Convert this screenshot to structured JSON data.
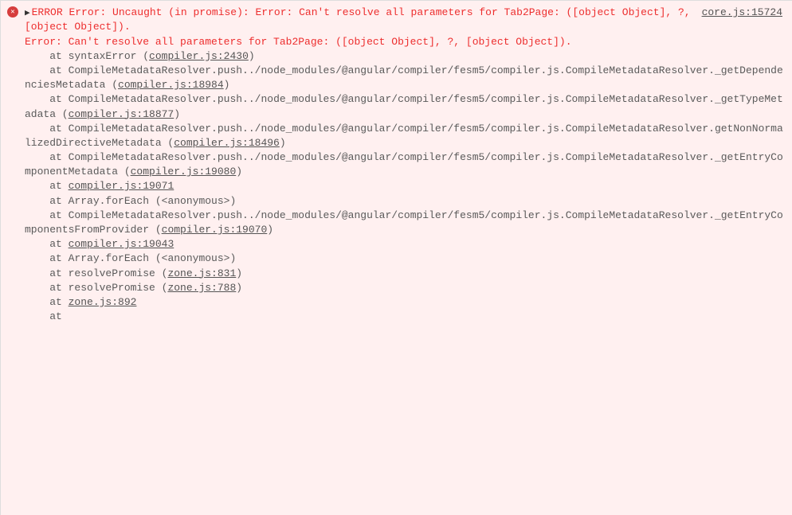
{
  "error": {
    "sourceLink": "core.js:15724",
    "headerPrefix": "ERROR",
    "headerMain": "Error: Uncaught (in promise): Error: Can't resolve all parameters for Tab2Page: ([object Object], ?, [object Object]).",
    "headerLine2": "Error: Can't resolve all parameters for Tab2Page: ([object Object], ?, [object Object]).",
    "stack": [
      {
        "prefix": "    at syntaxError (",
        "link": "compiler.js:2430",
        "suffix": ")"
      },
      {
        "prefix": "    at CompileMetadataResolver.push../node_modules/@angular/compiler/fesm5/compiler.js.CompileMetadataResolver._getDependenciesMetadata (",
        "link": "compiler.js:18984",
        "suffix": ")"
      },
      {
        "prefix": "    at CompileMetadataResolver.push../node_modules/@angular/compiler/fesm5/compiler.js.CompileMetadataResolver._getTypeMetadata (",
        "link": "compiler.js:18877",
        "suffix": ")"
      },
      {
        "prefix": "    at CompileMetadataResolver.push../node_modules/@angular/compiler/fesm5/compiler.js.CompileMetadataResolver.getNonNormalizedDirectiveMetadata (",
        "link": "compiler.js:18496",
        "suffix": ")"
      },
      {
        "prefix": "    at CompileMetadataResolver.push../node_modules/@angular/compiler/fesm5/compiler.js.CompileMetadataResolver._getEntryComponentMetadata (",
        "link": "compiler.js:19080",
        "suffix": ")"
      },
      {
        "prefix": "    at ",
        "link": "compiler.js:19071",
        "suffix": ""
      },
      {
        "prefix": "    at Array.forEach (<anonymous>)",
        "link": "",
        "suffix": ""
      },
      {
        "prefix": "    at CompileMetadataResolver.push../node_modules/@angular/compiler/fesm5/compiler.js.CompileMetadataResolver._getEntryComponentsFromProvider (",
        "link": "compiler.js:19070",
        "suffix": ")"
      },
      {
        "prefix": "    at ",
        "link": "compiler.js:19043",
        "suffix": ""
      },
      {
        "prefix": "    at Array.forEach (<anonymous>)",
        "link": "",
        "suffix": ""
      },
      {
        "prefix": "    at resolvePromise (",
        "link": "zone.js:831",
        "suffix": ")"
      },
      {
        "prefix": "    at resolvePromise (",
        "link": "zone.js:788",
        "suffix": ")"
      },
      {
        "prefix": "    at ",
        "link": "zone.js:892",
        "suffix": ""
      },
      {
        "prefix": "    at",
        "link": "",
        "suffix": ""
      }
    ]
  }
}
